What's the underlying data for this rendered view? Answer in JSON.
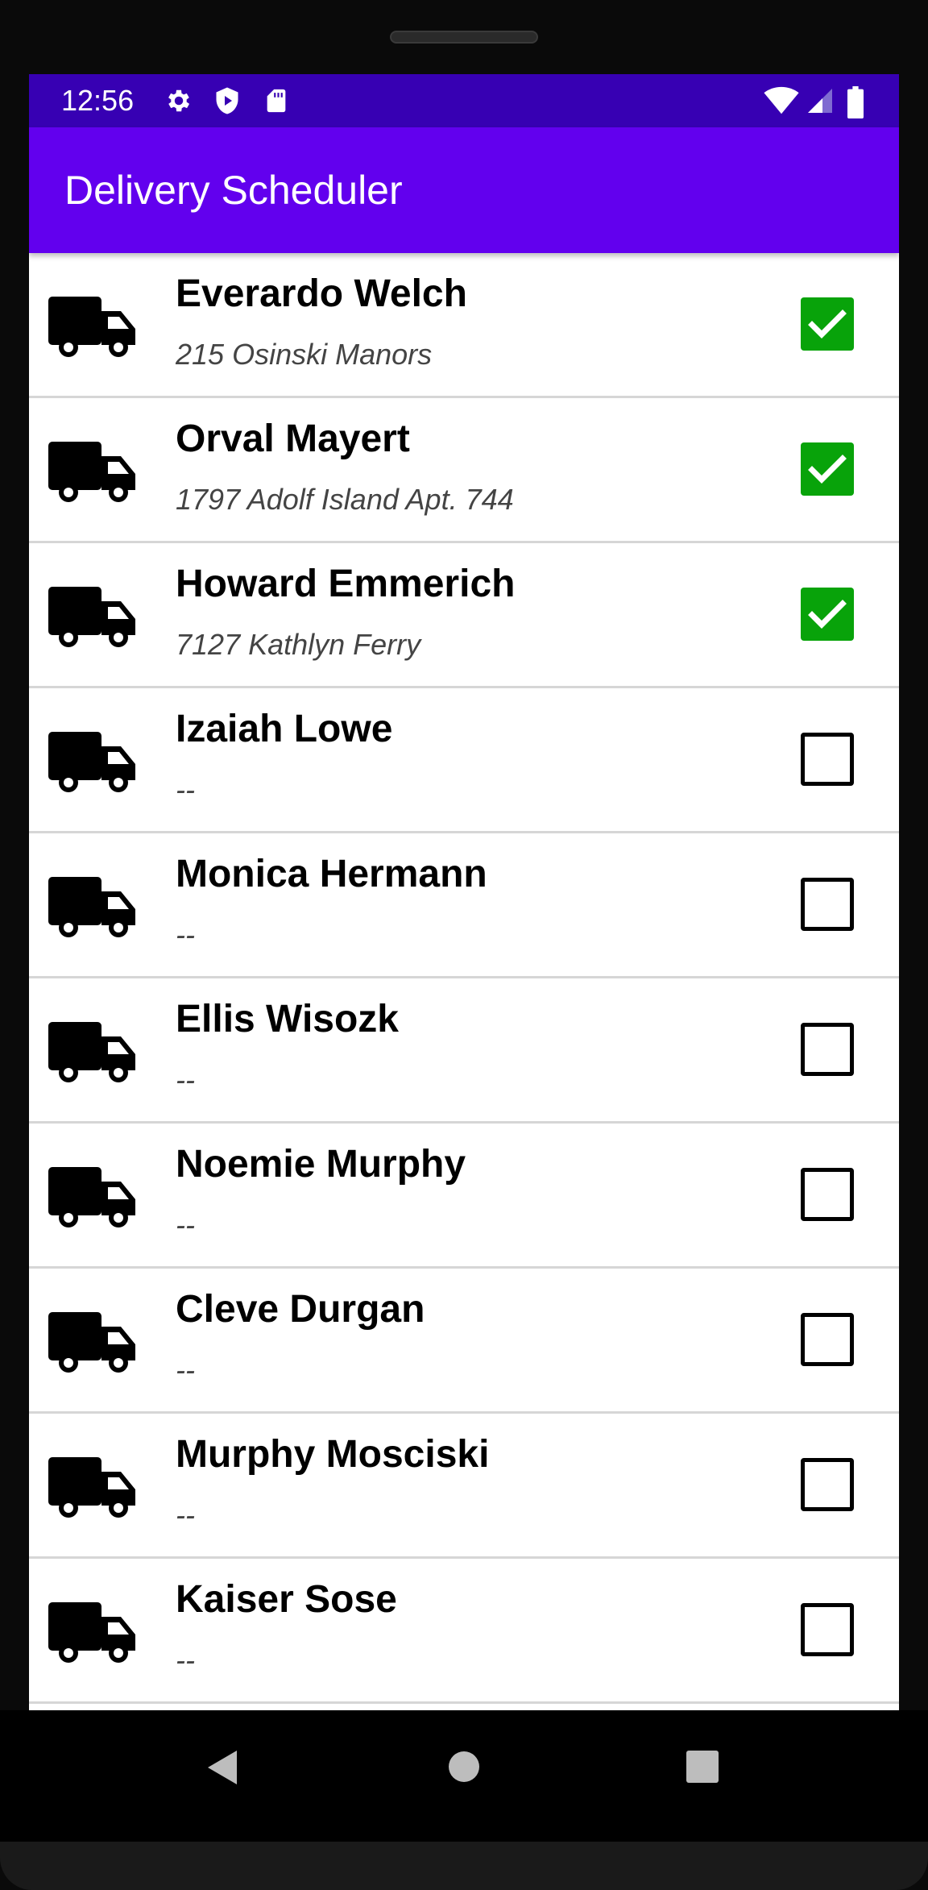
{
  "status_bar": {
    "time": "12:56",
    "icons": [
      "settings-gear-icon",
      "shield-play-icon",
      "sd-card-icon",
      "wifi-icon",
      "cell-signal-icon",
      "battery-icon"
    ]
  },
  "app_bar": {
    "title": "Delivery Scheduler"
  },
  "colors": {
    "status_bar": "#3700b3",
    "app_bar": "#6200ee",
    "checkbox_checked": "#08a30a",
    "divider": "#d6d6d6"
  },
  "deliveries": [
    {
      "name": "Everardo Welch",
      "address": "215 Osinski Manors",
      "checked": true
    },
    {
      "name": "Orval Mayert",
      "address": "1797 Adolf Island Apt. 744",
      "checked": true
    },
    {
      "name": "Howard Emmerich",
      "address": "7127 Kathlyn Ferry",
      "checked": true
    },
    {
      "name": "Izaiah Lowe",
      "address": "--",
      "checked": false
    },
    {
      "name": "Monica Hermann",
      "address": "--",
      "checked": false
    },
    {
      "name": "Ellis Wisozk",
      "address": "--",
      "checked": false
    },
    {
      "name": "Noemie Murphy",
      "address": "--",
      "checked": false
    },
    {
      "name": "Cleve Durgan",
      "address": "--",
      "checked": false
    },
    {
      "name": "Murphy Mosciski",
      "address": "--",
      "checked": false
    },
    {
      "name": "Kaiser Sose",
      "address": "--",
      "checked": false
    }
  ],
  "nav_bar": {
    "buttons": [
      "back-icon",
      "home-icon",
      "recents-icon"
    ]
  }
}
